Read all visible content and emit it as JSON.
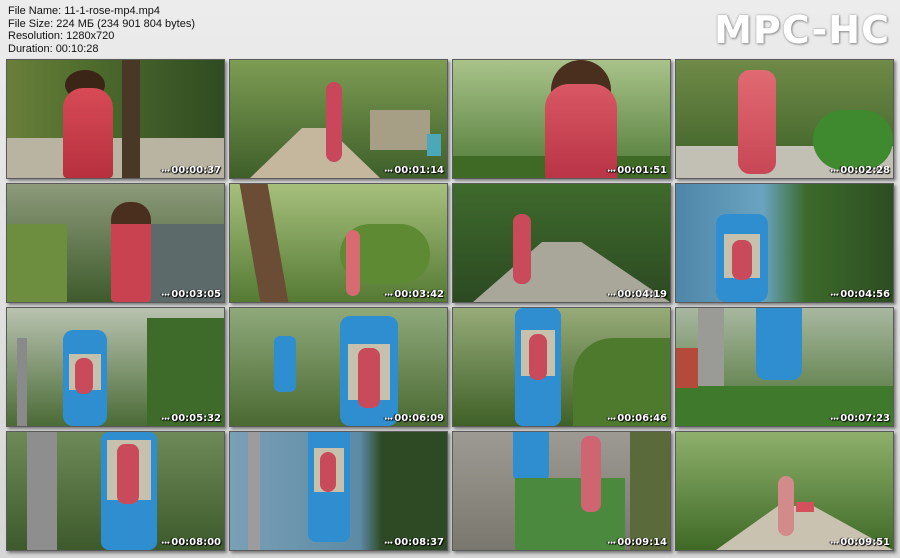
{
  "header": {
    "file_name": "File Name: 11-1-rose-mp4.mp4",
    "file_size": "File Size: 224 МБ (234 901 804 bytes)",
    "resolution": "Resolution: 1280x720",
    "duration": "Duration: 00:10:28"
  },
  "logo": "MPC-HC",
  "thumbnails": [
    {
      "time": "00:00:37",
      "scene": "woman-trees"
    },
    {
      "time": "00:01:14",
      "scene": "path-wall"
    },
    {
      "time": "00:01:51",
      "scene": "closeup-garden"
    },
    {
      "time": "00:02:28",
      "scene": "garden-path"
    },
    {
      "time": "00:03:05",
      "scene": "crowd-plants"
    },
    {
      "time": "00:03:42",
      "scene": "tree-trunk"
    },
    {
      "time": "00:04:19",
      "scene": "walkway-stairs"
    },
    {
      "time": "00:04:56",
      "scene": "cable-car-sea"
    },
    {
      "time": "00:05:32",
      "scene": "cable-car-pylon"
    },
    {
      "time": "00:06:09",
      "scene": "cable-car-two"
    },
    {
      "time": "00:06:46",
      "scene": "cable-car-center"
    },
    {
      "time": "00:07:23",
      "scene": "cable-car-hanging"
    },
    {
      "time": "00:08:00",
      "scene": "cable-car-cabin"
    },
    {
      "time": "00:08:37",
      "scene": "cable-car-water"
    },
    {
      "time": "00:09:14",
      "scene": "station-carpet"
    },
    {
      "time": "00:09:51",
      "scene": "park-path"
    }
  ]
}
